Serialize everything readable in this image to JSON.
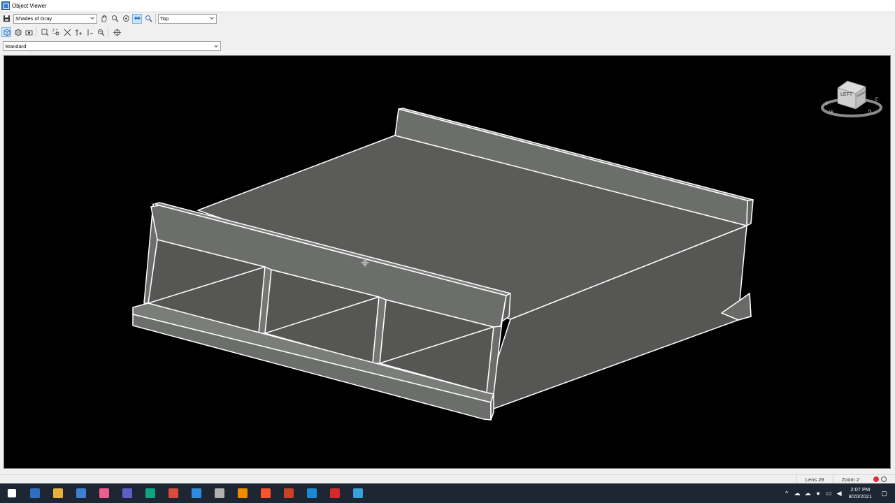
{
  "window": {
    "title": "Object Viewer",
    "icon": "object-viewer-app-icon"
  },
  "toolbar": {
    "visual_style": "Shades of Gray",
    "view": "Top",
    "ucs": "Standard",
    "row1_icons": [
      "save-icon",
      "pan-icon",
      "zoom-icon",
      "orbit-icon",
      "steering-icon",
      "zoom-window-icon"
    ],
    "row2_icons": [
      "box-view-icon",
      "shade-icon",
      "camera-icon",
      "zoom-extents-icon",
      "zoom-window-icon",
      "zoom-all-icon",
      "zoom-in-icon",
      "zoom-out-icon",
      "zoom-realtime-icon",
      "crosshair-icon"
    ]
  },
  "viewcube": {
    "face_label": "LEFT",
    "side_label": "FRONT",
    "compass_labels": [
      "S",
      "W",
      "N",
      "E"
    ]
  },
  "status": {
    "lens": "Lens 28",
    "zoom": "Zoom 2"
  },
  "taskbar": {
    "apps": [
      "windows-start-icon",
      "news-icon",
      "file-explorer-icon",
      "store-icon",
      "itunes-icon",
      "teams-icon",
      "chatgpt-icon",
      "wps-icon",
      "skype-icon",
      "unity-icon",
      "vlc-icon",
      "brave-icon",
      "powerpoint-icon",
      "edge-icon",
      "autocad-icon",
      "snowflake-icon"
    ],
    "app_colors": [
      "#ffffff",
      "#2f6fc0",
      "#e8b23a",
      "#3d7fd1",
      "#ec5e8f",
      "#5b5fc7",
      "#10a37f",
      "#d94c3d",
      "#2e8de0",
      "#b0b0b0",
      "#f08c00",
      "#fb542b",
      "#c84322",
      "#1a8ad4",
      "#d62a2a",
      "#3aa0d8"
    ],
    "time": "2:07 PM",
    "date": "8/20/2021"
  }
}
